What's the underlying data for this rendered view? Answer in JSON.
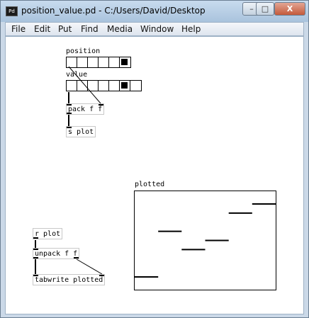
{
  "window": {
    "app_icon_label": "Pd",
    "title": "position_value.pd  - C:/Users/David/Desktop"
  },
  "title_buttons": {
    "minimize": "–",
    "maximize": "□",
    "close": "X"
  },
  "menu": [
    "File",
    "Edit",
    "Put",
    "Find",
    "Media",
    "Window",
    "Help"
  ],
  "patch": {
    "position_label": "position",
    "value_label": "value",
    "position_radio": {
      "cells": 6,
      "selected": 5
    },
    "value_radio": {
      "cells": 7,
      "selected": 5
    },
    "pack_obj": "pack f f",
    "send_obj": "s plot",
    "receive_obj": "r plot",
    "unpack_obj": "unpack f f",
    "tabwrite_obj": "tabwrite plotted",
    "array_name": "plotted",
    "array_values": [
      0,
      5,
      3,
      4,
      7,
      8
    ]
  }
}
